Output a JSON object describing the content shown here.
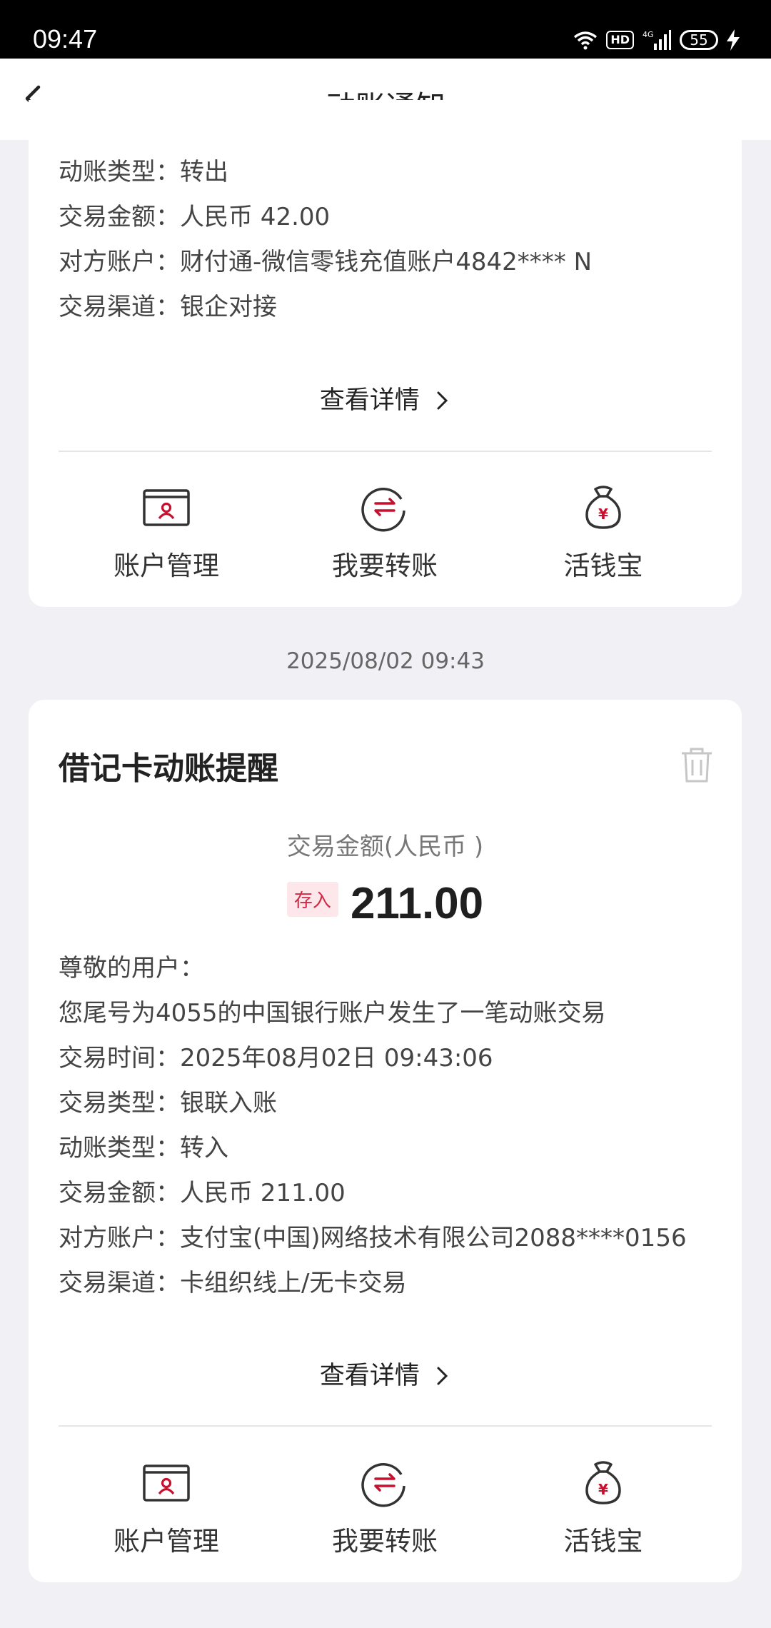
{
  "status_bar": {
    "time": "09:47",
    "network": "4G",
    "hd": "HD",
    "battery": "55"
  },
  "header": {
    "title": "动账通知",
    "back_icon": "chevron-left-icon"
  },
  "card1": {
    "lines": [
      "动账类型：转出",
      "交易金额：人民币 42.00",
      "对方账户：财付通-微信零钱充值账户4842****   N",
      "交易渠道：银企对接"
    ],
    "detail_link": "查看详情",
    "actions": [
      {
        "label": "账户管理",
        "icon": "account-card-icon"
      },
      {
        "label": "我要转账",
        "icon": "transfer-icon"
      },
      {
        "label": "活钱宝",
        "icon": "money-bag-icon"
      }
    ]
  },
  "timestamp": "2025/08/02 09:43",
  "card2": {
    "title": "借记卡动账提醒",
    "amount_label": "交易金额(人民币 )",
    "badge": "存入",
    "amount": "211.00",
    "lines": [
      "尊敬的用户：",
      "您尾号为4055的中国银行账户发生了一笔动账交易",
      "交易时间：2025年08月02日 09:43:06",
      "交易类型：银联入账",
      "动账类型：转入",
      "交易金额：人民币 211.00",
      "对方账户：支付宝(中国)网络技术有限公司2088****0156",
      "交易渠道：卡组织线上/无卡交易"
    ],
    "detail_link": "查看详情",
    "actions": [
      {
        "label": "账户管理",
        "icon": "account-card-icon"
      },
      {
        "label": "我要转账",
        "icon": "transfer-icon"
      },
      {
        "label": "活钱宝",
        "icon": "money-bag-icon"
      }
    ]
  },
  "colors": {
    "accent": "#c8102e",
    "background": "#f0f0f5",
    "badge_bg": "#fde7ea"
  }
}
